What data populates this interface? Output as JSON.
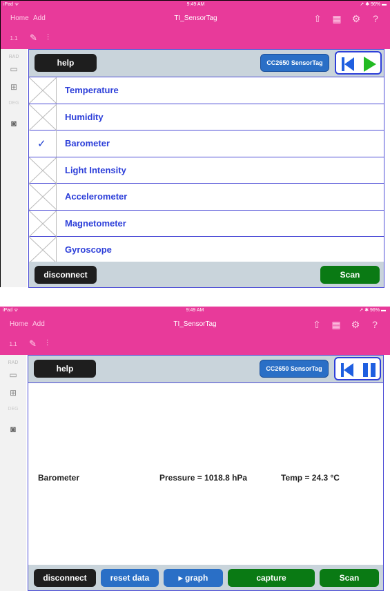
{
  "status": {
    "left": "iPad ᯤ",
    "time": "9:49 AM",
    "right": "↗ ✱ 96% ▬"
  },
  "nav": {
    "home": "Home",
    "add": "Add",
    "title": "TI_SensorTag"
  },
  "toolbar": {
    "page": "1.1"
  },
  "sidebar": {
    "rad": "RAD",
    "deg": "DEG"
  },
  "app": {
    "help": "help",
    "device": "CC2650 SensorTag",
    "disconnect": "disconnect",
    "scan": "Scan",
    "reset": "reset data",
    "graph": "▸ graph",
    "capture": "capture"
  },
  "sensors": [
    {
      "label": "Temperature",
      "checked": false
    },
    {
      "label": "Humidity",
      "checked": false
    },
    {
      "label": "Barometer",
      "checked": true
    },
    {
      "label": "Light Intensity",
      "checked": false
    },
    {
      "label": "Accelerometer",
      "checked": false
    },
    {
      "label": "Magnetometer",
      "checked": false
    },
    {
      "label": "Gyroscope",
      "checked": false
    }
  ],
  "check_mark": "✓",
  "reading": {
    "name": "Barometer",
    "pressure": "Pressure = 1018.8 hPa",
    "temp": "Temp = 24.3 °C"
  }
}
